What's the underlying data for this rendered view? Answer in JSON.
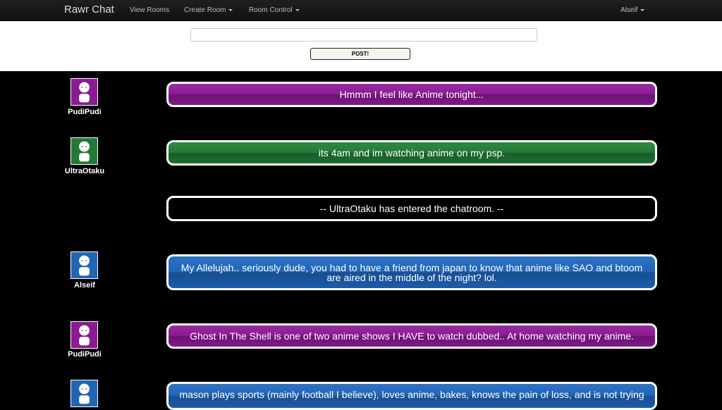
{
  "navbar": {
    "brand": "Rawr Chat",
    "view_rooms": "View Rooms",
    "create_room": "Create Room",
    "room_control": "Room Control",
    "user": "Alseif"
  },
  "composer": {
    "input_value": "",
    "post_label": "POST!"
  },
  "colors": {
    "purple": "#8a1b92",
    "green": "#237a37",
    "blue": "#2265b5"
  },
  "messages": [
    {
      "user": "PudiPudi",
      "avatar_color": "#8a1b92",
      "text": "Hmmm I feel like Anime tonight..."
    },
    {
      "user": "UltraOtaku",
      "avatar_color": "#237a37",
      "text": "its 4am and im watching anime on my psp."
    },
    {
      "user": "",
      "avatar_color": "",
      "text": "-- UltraOtaku has entered the chatroom. --"
    },
    {
      "user": "Alseif",
      "avatar_color": "#2265b5",
      "text": "My Allelujah.. seriously dude, you had to have a friend from japan to know that anime like SAO and btoom are aired in the middle of the night? lol."
    },
    {
      "user": "PudiPudi",
      "avatar_color": "#8a1b92",
      "text": "Ghost In The Shell is one of two anime shows I HAVE to watch dubbed.. At home watching my anime."
    },
    {
      "user": "",
      "avatar_color": "#2265b5",
      "text": "mason plays sports (mainly football I believe), loves anime, bakes, knows the pain of loss, and is not trying"
    }
  ]
}
